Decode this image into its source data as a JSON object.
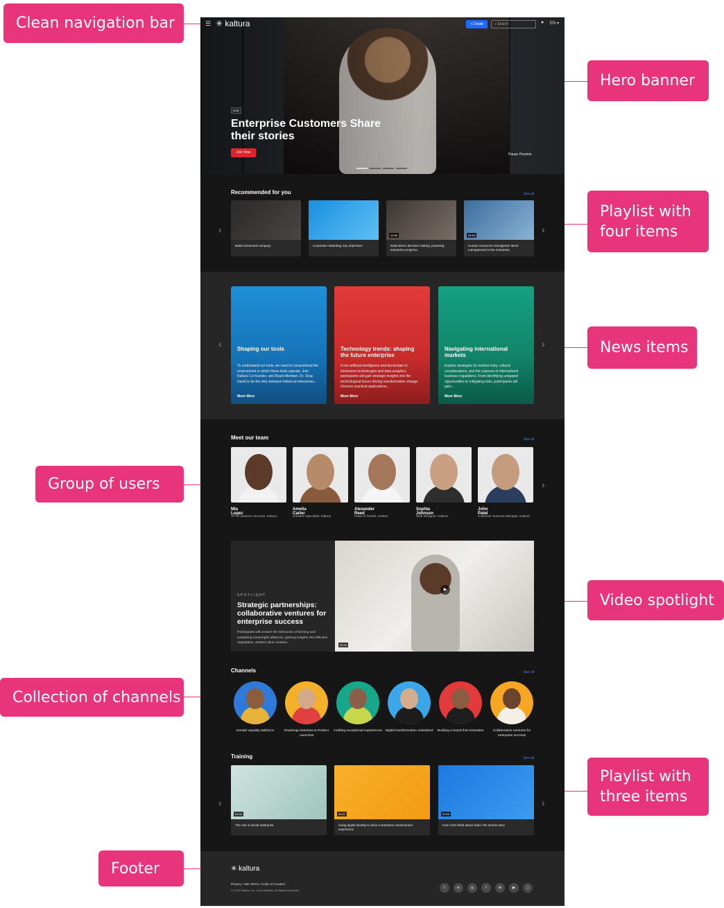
{
  "callouts": {
    "nav": "Clean navigation bar",
    "hero": "Hero banner",
    "playlist4": [
      "Playlist with",
      "four items"
    ],
    "news": "News items",
    "users": "Group of users",
    "spotlight": "Video spotlight",
    "channels": "Collection of channels",
    "playlist3": [
      "Playlist with",
      "three items"
    ],
    "footer": "Footer"
  },
  "nav": {
    "menu_icon": "hamburger-icon",
    "logo": "kaltura",
    "create": "+ Create",
    "search_placeholder": "Search",
    "language": "EN ▾"
  },
  "hero": {
    "badge": "LIVE",
    "title": "Enterprise Customers Share their stories",
    "cta": "Join Now",
    "preview": "Pause Preview"
  },
  "recommended": {
    "title": "Recommended for you",
    "see_all": "See all",
    "items": [
      {
        "label": "Build connected company",
        "duration": ""
      },
      {
        "label": "Corporate marketing: key objectives",
        "duration": ""
      },
      {
        "label": "Data-driven decision making: powering enterprise progress",
        "duration": "24:56"
      },
      {
        "label": "Human resources reimagined: talent management in the enterprise",
        "duration": "04:16"
      }
    ]
  },
  "news": {
    "more": "More More",
    "items": [
      {
        "title": "Shaping our tools",
        "desc": "To understand our tools, we need to comprehend the environment in which these tools operate. Join Kaltura Co-founder, and Board Member, Dr. Shay David to tie the dots between historical milestones..."
      },
      {
        "title": "Technology trends: shaping the future enterprise",
        "desc": "From artificial intelligence and blockchain to immersive technologies and data analytics, participants will gain strategic insights into the technological forces driving transformative change. Uncover practical applications..."
      },
      {
        "title": "Navigating international markets",
        "desc": "Explore strategies for market entry, cultural considerations, and the nuances of international business regulations. From identifying untapped opportunities to mitigating risks, participants will gain..."
      }
    ]
  },
  "team": {
    "title": "Meet our team",
    "see_all": "See all",
    "members": [
      {
        "name": "Mia Lopez",
        "role": "VP of customer success, Kaltura"
      },
      {
        "name": "Amelia Carter",
        "role": "Creative Specialist, Kaltura"
      },
      {
        "name": "Alexander Reed",
        "role": "Head of Trends, Kaltura"
      },
      {
        "name": "Sophia Johnson",
        "role": "Web Designer, Kaltura"
      },
      {
        "name": "John Patel",
        "role": "Customer Success Manager, Kaltura"
      }
    ]
  },
  "spotlight": {
    "kicker": "SPOTLIGHT",
    "title": "Strategic partnerships: collaborative ventures for enterprise success",
    "desc": "Participants will unravel the intricacies of forming and sustaining meaningful alliances, gaining insights into effective negotiation, shared value creation...",
    "duration": "02:34"
  },
  "channels": {
    "title": "Channels",
    "see_all": "See all",
    "items": [
      {
        "label": "Gender equality taskforce"
      },
      {
        "label": "Roadmap Sessions & Product Launches"
      },
      {
        "label": "Crafting exceptional experiences"
      },
      {
        "label": "Digital transformation unleashed"
      },
      {
        "label": "Building a brand that resonates"
      },
      {
        "label": "Collaborative ventures for enterprise success"
      }
    ]
  },
  "training": {
    "title": "Training",
    "see_all": "See all",
    "items": [
      {
        "label": "The role of social enterprise",
        "duration": "02:34"
      },
      {
        "label": "Using digital identity to drive a seamless omnichannel experience",
        "duration": "04:37"
      },
      {
        "label": "How CIOs think about video: the Oracle story",
        "duration": "01:59"
      }
    ]
  },
  "footer": {
    "logo": "kaltura",
    "links": "Privacy  •  Site Terms  •  Code of Conduct",
    "copyright": "© 2023 Kaltura, Inc. or its affiliates. All Rights Reserved",
    "social": [
      "twitter-icon",
      "linkedin-icon",
      "instagram-icon",
      "facebook-icon",
      "web-icon",
      "youtube-icon",
      "twitch-icon"
    ]
  },
  "colors": {
    "accent": "#e8347a",
    "primary": "#1f6bff",
    "cta": "#e0242c",
    "bg": "#161616"
  }
}
